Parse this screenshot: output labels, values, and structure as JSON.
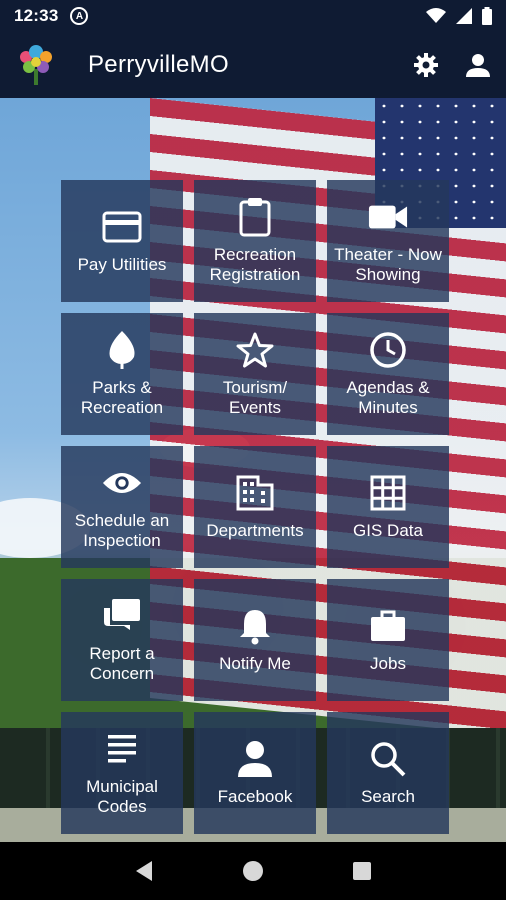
{
  "status_bar": {
    "time": "12:33",
    "badge": "A",
    "icons": [
      "wifi-icon",
      "signal-icon",
      "battery-icon"
    ]
  },
  "app_bar": {
    "title": "PerryvilleMO",
    "logo": "tree-logo",
    "actions": [
      "gear-icon",
      "account-icon"
    ]
  },
  "tiles": [
    {
      "label": "Pay Utilities",
      "icon": "credit-card-icon"
    },
    {
      "label": "Recreation\nRegistration",
      "icon": "clipboard-icon"
    },
    {
      "label": "Theater - Now\nShowing",
      "icon": "video-camera-icon"
    },
    {
      "label": "Parks &\nRecreation",
      "icon": "leaf-icon"
    },
    {
      "label": "Tourism/\nEvents",
      "icon": "star-icon"
    },
    {
      "label": "Agendas &\nMinutes",
      "icon": "clock-icon"
    },
    {
      "label": "Schedule an\nInspection",
      "icon": "eye-icon"
    },
    {
      "label": "Departments",
      "icon": "building-icon"
    },
    {
      "label": "GIS Data",
      "icon": "grid-icon"
    },
    {
      "label": "Report a\nConcern",
      "icon": "chat-bubbles-icon"
    },
    {
      "label": "Notify Me",
      "icon": "bell-icon"
    },
    {
      "label": "Jobs",
      "icon": "briefcase-icon"
    },
    {
      "label": "Municipal\nCodes",
      "icon": "document-lines-icon"
    },
    {
      "label": "Facebook",
      "icon": "person-icon"
    },
    {
      "label": "Search",
      "icon": "search-icon"
    }
  ],
  "nav_bar": {
    "buttons": [
      "back-icon",
      "home-icon",
      "recents-icon"
    ]
  },
  "colors": {
    "app_bar": "#0f1b33",
    "tile": "#24385c",
    "text": "#ffffff"
  }
}
